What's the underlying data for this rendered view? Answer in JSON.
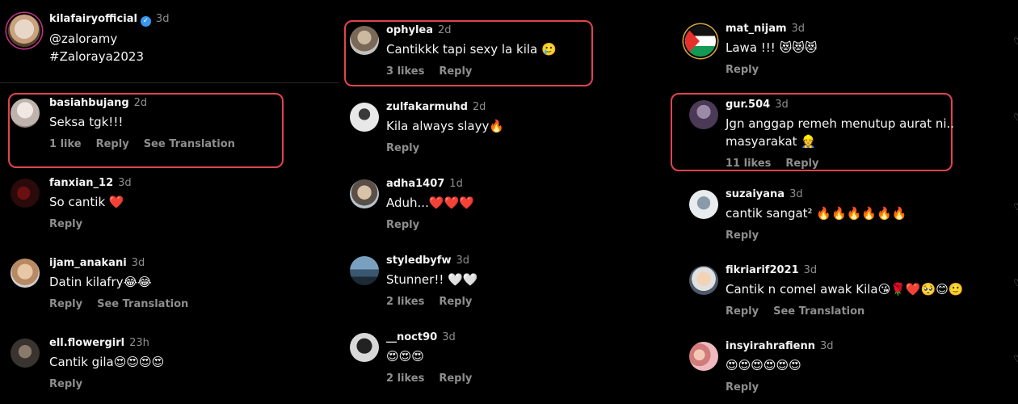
{
  "col1": [
    {
      "avatar": "profile-photo-pink-ring",
      "user": "kilafairyofficial",
      "verified": true,
      "time": "3d",
      "text": "@zaloramy\n#Zaloraya2023",
      "likes": "",
      "actions": []
    },
    {
      "avatar": "profile-photo",
      "user": "basiahbujang",
      "time": "2d",
      "text": "Seksa tgk!!!",
      "likes": "1 like",
      "actions": [
        "Reply",
        "See Translation"
      ]
    },
    {
      "avatar": "profile-photo",
      "user": "fanxian_12",
      "time": "3d",
      "text": "So cantik ❤️",
      "likes": "",
      "actions": [
        "Reply"
      ]
    },
    {
      "avatar": "profile-photo",
      "user": "ijam_anakani",
      "time": "3d",
      "text": "Datin kilafry😂😂",
      "likes": "",
      "actions": [
        "Reply",
        "See Translation"
      ]
    },
    {
      "avatar": "profile-photo",
      "user": "ell.flowergirl",
      "time": "23h",
      "text": "Cantik gila😍😍😍😍",
      "likes": "",
      "actions": [
        "Reply"
      ]
    }
  ],
  "col2": [
    {
      "avatar": "profile-photo",
      "user": "ophylea",
      "time": "2d",
      "text": "Cantikkk tapi sexy la kila 🥲",
      "likes": "3 likes",
      "actions": [
        "Reply"
      ]
    },
    {
      "avatar": "profile-photo",
      "user": "zulfakarmuhd",
      "time": "2d",
      "text": "Kila always slayy🔥",
      "likes": "",
      "actions": [
        "Reply"
      ]
    },
    {
      "avatar": "profile-photo",
      "user": "adha1407",
      "time": "1d",
      "text": "Aduh...❤️❤️❤️",
      "likes": "",
      "actions": [
        "Reply"
      ]
    },
    {
      "avatar": "profile-photo",
      "user": "styledbyfw",
      "time": "3d",
      "text": "Stunner!! 🤍🤍",
      "likes": "2 likes",
      "actions": [
        "Reply"
      ]
    },
    {
      "avatar": "profile-photo",
      "user": "__noct90",
      "time": "3d",
      "text": "😍😍😍",
      "likes": "2 likes",
      "actions": [
        "Reply"
      ]
    }
  ],
  "col3": [
    {
      "avatar": "palestine-flag-avatar",
      "user": "mat_nijam",
      "time": "3d",
      "text": "Lawa !!! 😻😻😻",
      "likes": "",
      "actions": [
        "Reply"
      ]
    },
    {
      "avatar": "profile-photo",
      "user": "gur.504",
      "time": "3d",
      "text": "Jgn anggap remeh menutup aurat ni..\nmasyarakat 👷",
      "likes": "11 likes",
      "actions": [
        "Reply"
      ]
    },
    {
      "avatar": "profile-photo",
      "user": "suzaiyana",
      "time": "3d",
      "text": "cantik sangat² 🔥🔥🔥🔥🔥🔥",
      "likes": "",
      "actions": [
        "Reply"
      ]
    },
    {
      "avatar": "profile-photo",
      "user": "fikriarif2021",
      "time": "3d",
      "text": "Cantik n comel awak Kila😘🌹❤️🥺😊🙂",
      "likes": "",
      "actions": [
        "Reply",
        "See Translation"
      ]
    },
    {
      "avatar": "profile-photo",
      "user": "insyirahrafienn",
      "time": "3d",
      "text": "😍😍😍😍😍😍",
      "likes": "",
      "actions": [
        "Reply"
      ]
    }
  ],
  "colors": {
    "highlight": "#e0444f",
    "muted": "#8e8e8e",
    "background": "#000000",
    "verified": "#3897f0"
  },
  "icons": {
    "like": "heart-outline-icon",
    "verified": "verified-badge-icon"
  }
}
